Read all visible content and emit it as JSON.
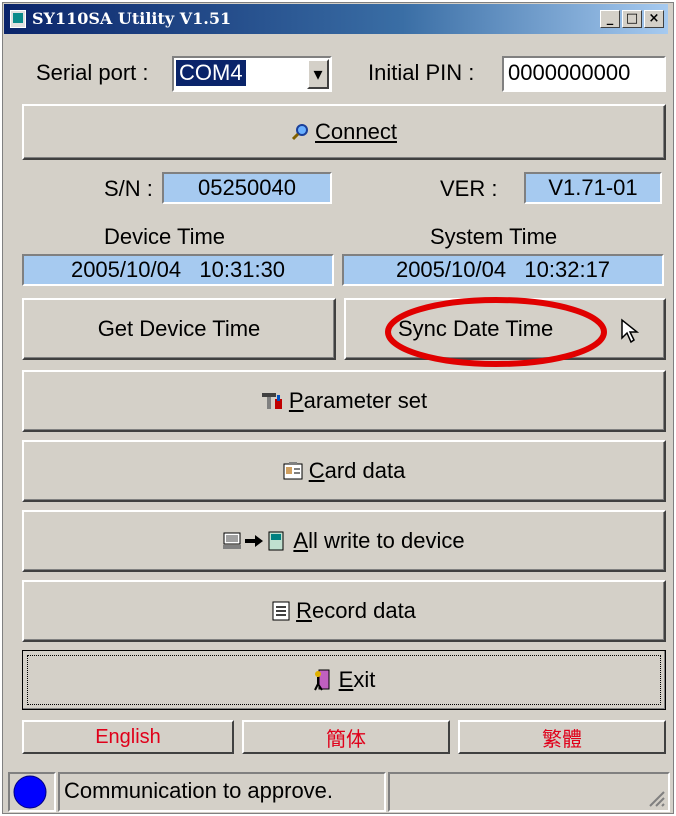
{
  "window": {
    "title": "SY110SA Utility V1.51",
    "min_label": "_",
    "max_label": "□",
    "close_label": "×"
  },
  "serial": {
    "label": "Serial port :",
    "value": "COM4",
    "dropdown_arrow": "▾",
    "pin_label": "Initial PIN :",
    "pin_value": "0000000000"
  },
  "connect": {
    "label": "Connect",
    "icon": "magnifier-icon"
  },
  "info": {
    "sn_label": "S/N :",
    "sn_value": "05250040",
    "ver_label": "VER :",
    "ver_value": "V1.71-01"
  },
  "time": {
    "device_label": "Device Time",
    "system_label": "System Time",
    "device_value": "2005/10/04   10:31:30",
    "system_value": "2005/10/04   10:32:17"
  },
  "buttons": {
    "get_device_time": "Get Device Time",
    "sync_date_time": "Sync Date Time",
    "parameter_set": "Parameter set",
    "card_data": "Card data",
    "all_write": "All write to device",
    "record_data": "Record data",
    "exit": "Exit"
  },
  "languages": [
    "English",
    "簡体",
    "繁體"
  ],
  "status": {
    "message": "Communication to approve.",
    "indicator_color": "#0000ff"
  },
  "colors": {
    "highlight_circle": "#e00000",
    "field_blue": "#a6caf0",
    "language_text": "#e0001a"
  }
}
